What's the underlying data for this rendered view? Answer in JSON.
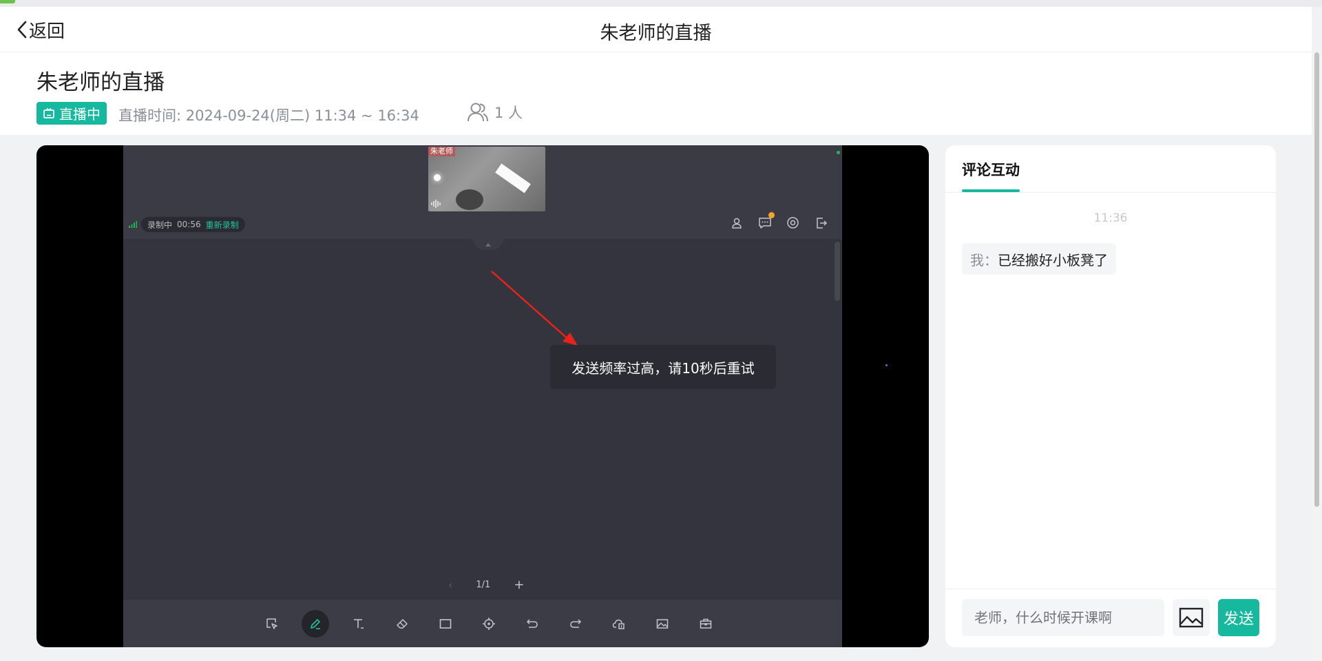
{
  "nav": {
    "back_label": "返回",
    "title": "朱老师的直播"
  },
  "info": {
    "title": "朱老师的直播",
    "status_badge": "直播中",
    "time": "直播时间: 2024-09-24(周二) 11:34 ~ 16:34",
    "viewers": "1 人"
  },
  "player": {
    "camera_label": "朱老师",
    "recording": {
      "status": "录制中",
      "duration": "00:56",
      "rerecord_label": "重新录制"
    },
    "top_icons": [
      "user-icon",
      "chat-icon",
      "settings-icon",
      "exit-icon"
    ],
    "toast": "发送频率过高，请10秒后重试",
    "pager": {
      "page": "1/1",
      "prev": "‹",
      "add": "+"
    },
    "tools": [
      "select-icon",
      "pen-icon",
      "text-icon",
      "eraser-icon",
      "rectangle-icon",
      "laser-pointer-icon",
      "undo-icon",
      "redo-icon",
      "cloud-upload-icon",
      "image-icon",
      "toolbox-icon"
    ],
    "active_tool": "pen-icon"
  },
  "side": {
    "tab_label": "评论互动",
    "messages": [
      {
        "time": "11:36",
        "sender": "我：",
        "text": "已经搬好小板凳了"
      }
    ],
    "input_placeholder": "老师，什么时候开课啊",
    "send_label": "发送"
  },
  "colors": {
    "accent": "#16b89e",
    "toast_bg": "#2b2c33",
    "whiteboard_bg": "#33343d",
    "notification": "#f5a623"
  }
}
